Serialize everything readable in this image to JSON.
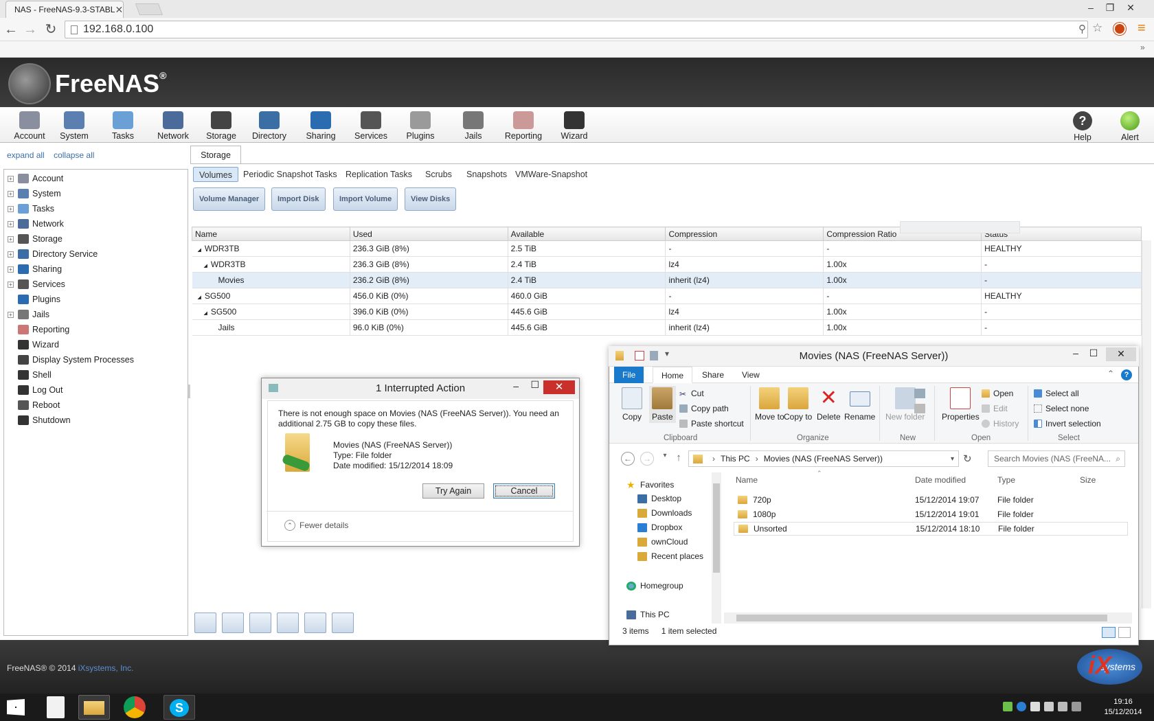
{
  "browser": {
    "tab_title": "NAS - FreeNAS-9.3-STABL",
    "url": "192.168.0.100"
  },
  "freenas": {
    "logo_text": "FreeNAS",
    "logo_reg": "®",
    "topnav": [
      {
        "label": "Account",
        "icon": "account-icon",
        "color": "#8a8fa0"
      },
      {
        "label": "System",
        "icon": "system-icon",
        "color": "#5a7fb0"
      },
      {
        "label": "Tasks",
        "icon": "tasks-icon",
        "color": "#6aa0d6"
      },
      {
        "label": "Network",
        "icon": "network-icon",
        "color": "#4b6c9a"
      },
      {
        "label": "Storage",
        "icon": "storage-icon",
        "color": "#444444"
      },
      {
        "label": "Directory",
        "icon": "directory-icon",
        "color": "#3a6ea5"
      },
      {
        "label": "Sharing",
        "icon": "sharing-icon",
        "color": "#2b6cb0"
      },
      {
        "label": "Services",
        "icon": "services-icon",
        "color": "#555555"
      },
      {
        "label": "Plugins",
        "icon": "plugins-icon",
        "color": "#9a9a9a"
      },
      {
        "label": "Jails",
        "icon": "jails-icon",
        "color": "#777777"
      },
      {
        "label": "Reporting",
        "icon": "reporting-icon",
        "color": "#c99"
      },
      {
        "label": "Wizard",
        "icon": "wizard-icon",
        "color": "#333333"
      }
    ],
    "help_label": "Help",
    "alert_label": "Alert",
    "expand_all": "expand all",
    "collapse_all": "collapse all",
    "tree": [
      {
        "label": "Account",
        "expandable": true,
        "icon": "account-icon"
      },
      {
        "label": "System",
        "expandable": true,
        "icon": "system-icon"
      },
      {
        "label": "Tasks",
        "expandable": true,
        "icon": "tasks-icon"
      },
      {
        "label": "Network",
        "expandable": true,
        "icon": "network-icon"
      },
      {
        "label": "Storage",
        "expandable": true,
        "icon": "storage-icon"
      },
      {
        "label": "Directory Service",
        "expandable": true,
        "icon": "directory-icon"
      },
      {
        "label": "Sharing",
        "expandable": true,
        "icon": "sharing-icon"
      },
      {
        "label": "Services",
        "expandable": true,
        "icon": "services-icon"
      },
      {
        "label": "Plugins",
        "expandable": false,
        "icon": "plugins-icon"
      },
      {
        "label": "Jails",
        "expandable": true,
        "icon": "jails-icon"
      },
      {
        "label": "Reporting",
        "expandable": false,
        "icon": "reporting-icon"
      },
      {
        "label": "Wizard",
        "expandable": false,
        "icon": "wizard-icon"
      },
      {
        "label": "Display System Processes",
        "expandable": false,
        "icon": "processes-icon"
      },
      {
        "label": "Shell",
        "expandable": false,
        "icon": "shell-icon"
      },
      {
        "label": "Log Out",
        "expandable": false,
        "icon": "logout-icon"
      },
      {
        "label": "Reboot",
        "expandable": false,
        "icon": "reboot-icon"
      },
      {
        "label": "Shutdown",
        "expandable": false,
        "icon": "shutdown-icon"
      }
    ],
    "storage_tab": "Storage",
    "subtabs": [
      "Volumes",
      "Periodic Snapshot Tasks",
      "Replication Tasks",
      "Scrubs",
      "Snapshots",
      "VMWare-Snapshot"
    ],
    "action_buttons": [
      "Volume Manager",
      "Import Disk",
      "Import Volume",
      "View Disks"
    ],
    "columns": [
      "Name",
      "Used",
      "Available",
      "Compression",
      "Compression Ratio",
      "Status"
    ],
    "rows": [
      {
        "indent": 0,
        "arrow": "◢",
        "name": "WDR3TB",
        "used": "236.3 GiB (8%)",
        "avail": "2.5 TiB",
        "comp": "-",
        "ratio": "-",
        "status": "HEALTHY"
      },
      {
        "indent": 1,
        "arrow": "◢",
        "name": "WDR3TB",
        "used": "236.3 GiB (8%)",
        "avail": "2.4 TiB",
        "comp": "lz4",
        "ratio": "1.00x",
        "status": "-"
      },
      {
        "indent": 2,
        "arrow": "",
        "name": "Movies",
        "used": "236.2 GiB (8%)",
        "avail": "2.4 TiB",
        "comp": "inherit (lz4)",
        "ratio": "1.00x",
        "status": "-"
      },
      {
        "indent": 0,
        "arrow": "◢",
        "name": "SG500",
        "used": "456.0 KiB (0%)",
        "avail": "460.0 GiB",
        "comp": "-",
        "ratio": "-",
        "status": "HEALTHY"
      },
      {
        "indent": 1,
        "arrow": "◢",
        "name": "SG500",
        "used": "396.0 KiB (0%)",
        "avail": "445.6 GiB",
        "comp": "lz4",
        "ratio": "1.00x",
        "status": "-"
      },
      {
        "indent": 2,
        "arrow": "",
        "name": "Jails",
        "used": "96.0 KiB (0%)",
        "avail": "445.6 GiB",
        "comp": "inherit (lz4)",
        "ratio": "1.00x",
        "status": "-"
      }
    ],
    "footer_text": "FreeNAS® © 2014 ",
    "footer_link": "iXsystems, Inc.",
    "ix_logo": "systems"
  },
  "dialog": {
    "title": "1 Interrupted Action",
    "message": "There is not enough space on Movies (NAS (FreeNAS Server)). You need an additional 2.75 GB to copy these files.",
    "item_name": "Movies (NAS (FreeNAS Server))",
    "item_type": "Type: File folder",
    "item_date": "Date modified: 15/12/2014 18:09",
    "try_again": "Try Again",
    "cancel": "Cancel",
    "fewer_details": "Fewer details"
  },
  "explorer": {
    "title": "Movies (NAS (FreeNAS Server))",
    "ribbon_tabs": [
      "File",
      "Home",
      "Share",
      "View"
    ],
    "clipboard": {
      "copy": "Copy",
      "paste": "Paste",
      "cut": "Cut",
      "copy_path": "Copy path",
      "paste_shortcut": "Paste shortcut",
      "group": "Clipboard"
    },
    "organize": {
      "move_to": "Move to",
      "copy_to": "Copy to",
      "delete": "Delete",
      "rename": "Rename",
      "group": "Organize"
    },
    "new": {
      "new_folder": "New folder",
      "group": "New"
    },
    "open": {
      "properties": "Properties",
      "open": "Open",
      "edit": "Edit",
      "history": "History",
      "group": "Open"
    },
    "select": {
      "select_all": "Select all",
      "select_none": "Select none",
      "invert": "Invert selection",
      "group": "Select"
    },
    "address": [
      "This PC",
      "Movies (NAS (FreeNAS Server))"
    ],
    "search_placeholder": "Search Movies (NAS (FreeNA...",
    "nav": {
      "favorites": "Favorites",
      "items": [
        "Desktop",
        "Downloads",
        "Dropbox",
        "ownCloud",
        "Recent places"
      ],
      "homegroup": "Homegroup",
      "this_pc": "This PC"
    },
    "columns": [
      "Name",
      "Date modified",
      "Type",
      "Size"
    ],
    "files": [
      {
        "name": "720p",
        "date": "15/12/2014 19:07",
        "type": "File folder"
      },
      {
        "name": "1080p",
        "date": "15/12/2014 19:01",
        "type": "File folder"
      },
      {
        "name": "Unsorted",
        "date": "15/12/2014 18:10",
        "type": "File folder"
      }
    ],
    "status_items": "3 items",
    "status_selected": "1 item selected"
  },
  "taskbar": {
    "time": "19:16",
    "date": "15/12/2014"
  }
}
